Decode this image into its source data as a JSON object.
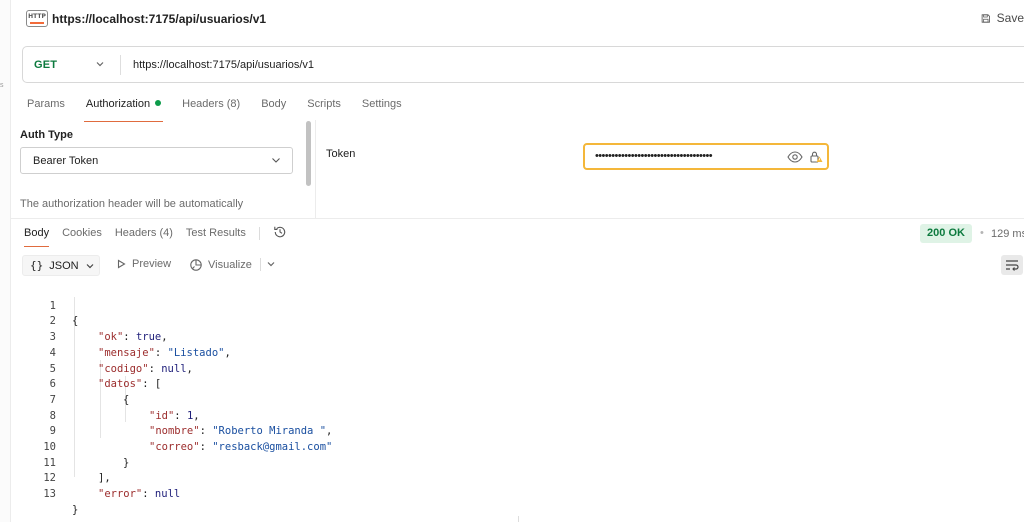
{
  "title": "https://localhost:7175/api/usuarios/v1",
  "http_badge": "HTTP",
  "save_label": "Save",
  "request": {
    "method": "GET",
    "url": "https://localhost:7175/api/usuarios/v1",
    "tabs": [
      {
        "label": "Params"
      },
      {
        "label": "Authorization"
      },
      {
        "label": "Headers (8)"
      },
      {
        "label": "Body"
      },
      {
        "label": "Scripts"
      },
      {
        "label": "Settings"
      }
    ]
  },
  "auth": {
    "type_label": "Auth Type",
    "type_value": "Bearer Token",
    "description": "The authorization header will be automatically",
    "token_label": "Token",
    "token_masked": "••••••••••••••••••••••••••••••••••••"
  },
  "response": {
    "tabs": [
      {
        "label": "Body"
      },
      {
        "label": "Cookies"
      },
      {
        "label": "Headers (4)"
      },
      {
        "label": "Test Results"
      }
    ],
    "status": "200 OK",
    "separator": "•",
    "time": "129 ms",
    "format": "JSON",
    "braces": "{}",
    "preview_label": "Preview",
    "visualize_label": "Visualize",
    "code_lines": [
      {
        "n": "1"
      },
      {
        "n": "2"
      },
      {
        "n": "3"
      },
      {
        "n": "4"
      },
      {
        "n": "5"
      },
      {
        "n": "6"
      },
      {
        "n": "7"
      },
      {
        "n": "8"
      },
      {
        "n": "9"
      },
      {
        "n": "10"
      },
      {
        "n": "11"
      },
      {
        "n": "12"
      },
      {
        "n": "13"
      }
    ],
    "json": {
      "open_brace": "{",
      "ok_key": "\"ok\"",
      "ok_val": "true",
      "mensaje_key": "\"mensaje\"",
      "mensaje_val": "\"Listado\"",
      "codigo_key": "\"codigo\"",
      "codigo_val": "null",
      "datos_key": "\"datos\"",
      "open_bracket": "[",
      "inner_open": "{",
      "id_key": "\"id\"",
      "id_val": "1",
      "nombre_key": "\"nombre\"",
      "nombre_val": "\"Roberto Miranda \"",
      "correo_key": "\"correo\"",
      "correo_val": "\"resback@gmail.com\"",
      "inner_close": "}",
      "close_bracket": "],",
      "error_key": "\"error\"",
      "error_val": "null",
      "close_brace": "}",
      "colon": ": ",
      "comma": ","
    }
  },
  "colors": {
    "accent": "#e06b3e",
    "method_get": "#0c7a3e",
    "status_ok_bg": "#dff3e6",
    "token_border": "#f4b73a",
    "json_key": "#9c2d2d",
    "json_string": "#1a4fa0"
  }
}
